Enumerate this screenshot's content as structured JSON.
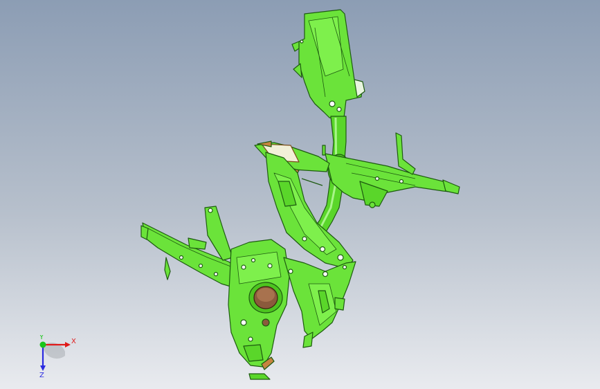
{
  "viewport": {
    "background_top": "#8c9db4",
    "background_bottom": "#e9ebef"
  },
  "model": {
    "part_color": "#6be33a",
    "edge_color": "#1d5a10",
    "hole_color": "#8b5a3c",
    "bracket_color": "#c7843f"
  },
  "triad": {
    "x_label": "X",
    "y_label": "Y",
    "z_label": "Z",
    "x_color": "#e01a1a",
    "y_color": "#19c419",
    "z_color": "#2a2ae0"
  }
}
